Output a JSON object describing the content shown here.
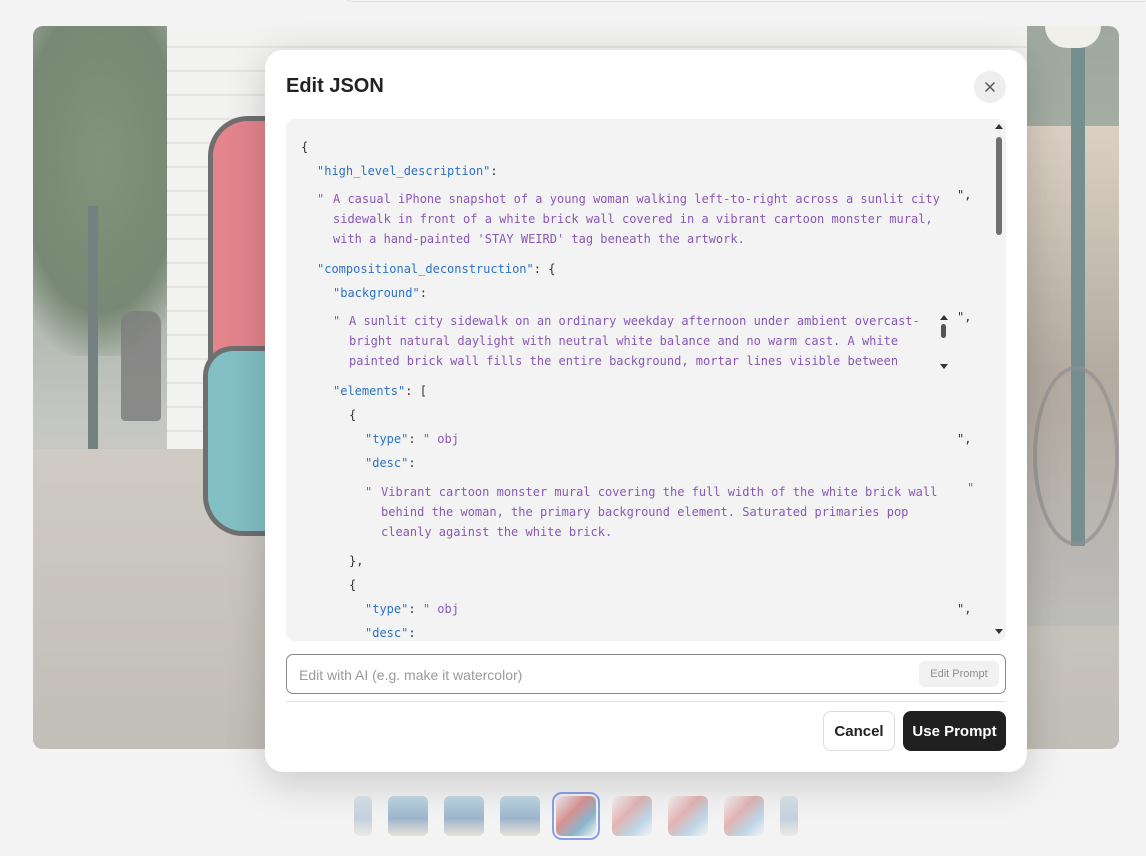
{
  "modal": {
    "title": "Edit JSON",
    "close_icon": "close-icon"
  },
  "editor": {
    "lines": {
      "l1": "{",
      "l2_key": "\"high_level_description\"",
      "l2_punct": ":",
      "l3_open": "\"",
      "l3_text": "A casual iPhone snapshot of a young woman walking left-to-right across a sunlit city",
      "l3_close": "\",",
      "l4_text": "sidewalk in front of a white brick wall covered in a vibrant cartoon monster mural,",
      "l5_text": "with a hand-painted 'STAY WEIRD' tag beneath the artwork.",
      "l6_key": "\"compositional_deconstruction\"",
      "l6_punct": ": {",
      "l7_key": "\"background\"",
      "l7_punct": ":",
      "l8_open": "\"",
      "l8_text": "A sunlit city sidewalk on an ordinary weekday afternoon under ambient overcast-",
      "l8_close": "\",",
      "l9_text": "bright natural daylight with neutral white balance and no warm cast. A white",
      "l10_text": "painted brick wall fills the entire background, mortar lines visible between",
      "l11_key": "\"elements\"",
      "l11_punct": ": [",
      "l12": "{",
      "l13_key": "\"type\"",
      "l13_punct": ": ",
      "l13_val": "\" obj",
      "l13_close": "\",",
      "l14_key": "\"desc\"",
      "l14_punct": ":",
      "l15_open": "\"",
      "l15_text": "Vibrant cartoon monster mural covering the full width of the white brick wall",
      "l15_close": "\"",
      "l16_text": "behind the woman, the primary background element. Saturated primaries pop",
      "l17_text": "cleanly against the white brick.",
      "l18": "},",
      "l19": "{",
      "l20_key": "\"type\"",
      "l20_punct": ": ",
      "l20_val": "\" obj",
      "l20_close": "\",",
      "l21_key": "\"desc\"",
      "l21_punct": ":"
    }
  },
  "ai_edit": {
    "placeholder": "Edit with AI (e.g. make it watercolor)",
    "value": "",
    "button_label": "Edit Prompt"
  },
  "actions": {
    "cancel_label": "Cancel",
    "use_prompt_label": "Use Prompt"
  },
  "thumbnails": {
    "count": 9,
    "active_index": 4
  }
}
